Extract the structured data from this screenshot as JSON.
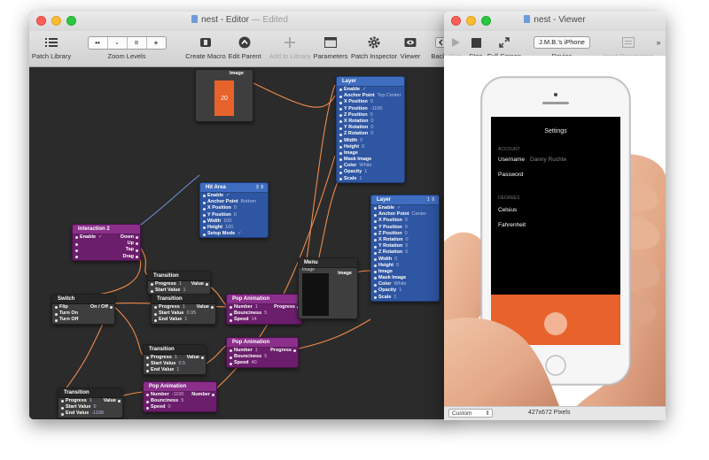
{
  "editor": {
    "title": "nest - Editor",
    "edited": "— Edited",
    "toolbar": {
      "patch_library": "Patch Library",
      "zoom_levels": "Zoom Levels",
      "zoom_buttons": [
        "••",
        "-",
        "=",
        "+"
      ],
      "create_macro": "Create Macro",
      "edit_parent": "Edit Parent",
      "add_to_library": "Add to Library",
      "parameters": "Parameters",
      "patch_inspector": "Patch Inspector",
      "viewer": "Viewer",
      "back_front": "Back/F"
    },
    "nodes": {
      "image_top": {
        "title": "Image",
        "preview_value": "20"
      },
      "layer1": {
        "title": "Layer",
        "badge": "",
        "rows": [
          {
            "k": "Enable",
            "v": "✓"
          },
          {
            "k": "Anchor Point",
            "v": "Top Center"
          },
          {
            "k": "X Position",
            "v": "0"
          },
          {
            "k": "Y Position",
            "v": "-1100"
          },
          {
            "k": "Z Position",
            "v": "0"
          },
          {
            "k": "X Rotation",
            "v": "0"
          },
          {
            "k": "Y Rotation",
            "v": "0"
          },
          {
            "k": "Z Rotation",
            "v": "0"
          },
          {
            "k": "Width",
            "v": "0"
          },
          {
            "k": "Height",
            "v": "0"
          },
          {
            "k": "Image",
            "v": ""
          },
          {
            "k": "Mask Image",
            "v": ""
          },
          {
            "k": "Color",
            "v": "White"
          },
          {
            "k": "Opacity",
            "v": "1"
          },
          {
            "k": "Scale",
            "v": "1"
          }
        ]
      },
      "hit_area": {
        "title": "Hit Area",
        "badge": "3 ⇕",
        "rows": [
          {
            "k": "Enable",
            "v": "✓"
          },
          {
            "k": "Anchor Point",
            "v": "Bottom"
          },
          {
            "k": "X Position",
            "v": "0"
          },
          {
            "k": "Y Position",
            "v": "0"
          },
          {
            "k": "Width",
            "v": "100"
          },
          {
            "k": "Height",
            "v": "100"
          },
          {
            "k": "Setup Mode",
            "v": "✓"
          }
        ]
      },
      "interaction": {
        "title": "Interaction 2",
        "rows": [
          {
            "k": "Enable",
            "v": "✓",
            "o": "Down"
          },
          {
            "k": "",
            "v": "",
            "o": "Up"
          },
          {
            "k": "",
            "v": "",
            "o": "Tap"
          },
          {
            "k": "",
            "v": "",
            "o": "Drag"
          }
        ]
      },
      "transition1": {
        "title": "Transition",
        "rows": [
          {
            "k": "Progress",
            "v": "1",
            "o": "Value"
          },
          {
            "k": "Start Value",
            "v": "1",
            "o": ""
          }
        ]
      },
      "transition2": {
        "title": "Transition",
        "rows": [
          {
            "k": "Progress",
            "v": "1",
            "o": "Value"
          },
          {
            "k": "Start Value",
            "v": "0.95",
            "o": ""
          },
          {
            "k": "End Value",
            "v": "1",
            "o": ""
          }
        ]
      },
      "transition3": {
        "title": "Transition",
        "rows": [
          {
            "k": "Progress",
            "v": "1",
            "o": "Value"
          },
          {
            "k": "Start Value",
            "v": "0.5",
            "o": ""
          },
          {
            "k": "End Value",
            "v": "1",
            "o": ""
          }
        ]
      },
      "transition4": {
        "title": "Transition",
        "rows": [
          {
            "k": "Progress",
            "v": "1",
            "o": "Value"
          },
          {
            "k": "Start Value",
            "v": "0",
            "o": ""
          },
          {
            "k": "End Value",
            "v": "-1100",
            "o": ""
          }
        ]
      },
      "switch": {
        "title": "Switch",
        "rows": [
          {
            "k": "Flip",
            "v": "",
            "o": "On / Off"
          },
          {
            "k": "Turn On",
            "v": "",
            "o": ""
          },
          {
            "k": "Turn Off",
            "v": "",
            "o": ""
          }
        ]
      },
      "pop1": {
        "title": "Pop Animation",
        "rows": [
          {
            "k": "Number",
            "v": "1",
            "o": "Progress"
          },
          {
            "k": "Bounciness",
            "v": "5",
            "o": ""
          },
          {
            "k": "Speed",
            "v": "14",
            "o": ""
          }
        ]
      },
      "pop2": {
        "title": "Pop Animation",
        "rows": [
          {
            "k": "Number",
            "v": "1",
            "o": "Progress"
          },
          {
            "k": "Bounciness",
            "v": "5",
            "o": ""
          },
          {
            "k": "Speed",
            "v": "40",
            "o": ""
          }
        ]
      },
      "pop3": {
        "title": "Pop Animation",
        "rows": [
          {
            "k": "Number",
            "v": "-1100",
            "o": "Number"
          },
          {
            "k": "Bounciness",
            "v": "5",
            "o": ""
          },
          {
            "k": "Speed",
            "v": "0",
            "o": ""
          }
        ]
      },
      "menu": {
        "title": "Menu",
        "sub": "Image",
        "out": "Image"
      },
      "layer2": {
        "title": "Layer",
        "badge": "1 ⇕",
        "rows": [
          {
            "k": "Enable",
            "v": "✓"
          },
          {
            "k": "Anchor Point",
            "v": "Center"
          },
          {
            "k": "X Position",
            "v": "0"
          },
          {
            "k": "Y Position",
            "v": "0"
          },
          {
            "k": "Z Position",
            "v": "0"
          },
          {
            "k": "X Rotation",
            "v": "0"
          },
          {
            "k": "Y Rotation",
            "v": "0"
          },
          {
            "k": "Z Rotation",
            "v": "0"
          },
          {
            "k": "Width",
            "v": "0"
          },
          {
            "k": "Height",
            "v": "0"
          },
          {
            "k": "Image",
            "v": ""
          },
          {
            "k": "Mask Image",
            "v": ""
          },
          {
            "k": "Color",
            "v": "White"
          },
          {
            "k": "Opacity",
            "v": "1"
          },
          {
            "k": "Scale",
            "v": "1"
          }
        ]
      }
    }
  },
  "viewer": {
    "title": "nest - Viewer",
    "toolbar": {
      "run": "Run",
      "stop": "Stop",
      "full_screen": "Full-Screen",
      "device_value": "J.M.B.'s iPhone",
      "device_label": "Device",
      "input_parameters": "Input Parameters"
    },
    "phone": {
      "settings_title": "Settings",
      "account_header": "ACCOUNT",
      "username_label": "Username",
      "username_value": "Danny Ruchte",
      "password_label": "Password",
      "degrees_header": "DEGREES",
      "celsius": "Celsius",
      "fahrenheit": "Fahrenheit"
    },
    "status": {
      "size_select": "Custom",
      "pixels": "427x672 Pixels"
    }
  },
  "colors": {
    "accent_orange": "#e8622b",
    "node_blue": "#3f6dc0",
    "node_purple": "#8b2f8b",
    "canvas": "#2b2b2b",
    "wire_orange": "#f08a4b",
    "wire_blue": "#6d8fd8"
  }
}
